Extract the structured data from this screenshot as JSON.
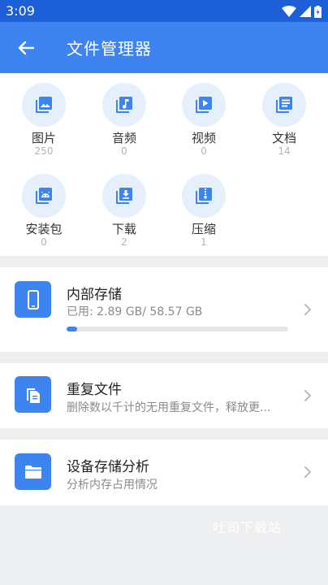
{
  "status_bar": {
    "time": "3:09",
    "icons": [
      "wifi-icon",
      "signal-icon",
      "battery-icon"
    ]
  },
  "app_bar": {
    "title": "文件管理器",
    "back_icon": "back-arrow-icon"
  },
  "categories": [
    {
      "label": "图片",
      "count": "250",
      "icon": "image-icon"
    },
    {
      "label": "音频",
      "count": "0",
      "icon": "music-icon"
    },
    {
      "label": "视频",
      "count": "0",
      "icon": "video-icon"
    },
    {
      "label": "文档",
      "count": "14",
      "icon": "document-icon"
    },
    {
      "label": "安装包",
      "count": "0",
      "icon": "android-package-icon"
    },
    {
      "label": "下载",
      "count": "2",
      "icon": "download-icon"
    },
    {
      "label": "压缩",
      "count": "1",
      "icon": "zip-icon"
    }
  ],
  "storage": {
    "title": "内部存储",
    "usage_text": "已用: 2.89 GB/ 58.57 GB",
    "used_fraction": 0.049,
    "icon": "phone-icon"
  },
  "duplicates": {
    "title": "重复文件",
    "subtitle": "删除数以千计的无用重复文件，释放更...",
    "icon": "duplicate-files-icon"
  },
  "analysis": {
    "title": "设备存储分析",
    "subtitle": "分析内存占用情况",
    "icon": "folder-icon"
  },
  "watermark": "吐司下载站",
  "colors": {
    "accent": "#3e84f1",
    "status_bar": "#1c5fd7",
    "icon_bg": "#e6effc",
    "background": "#eeeff1"
  }
}
